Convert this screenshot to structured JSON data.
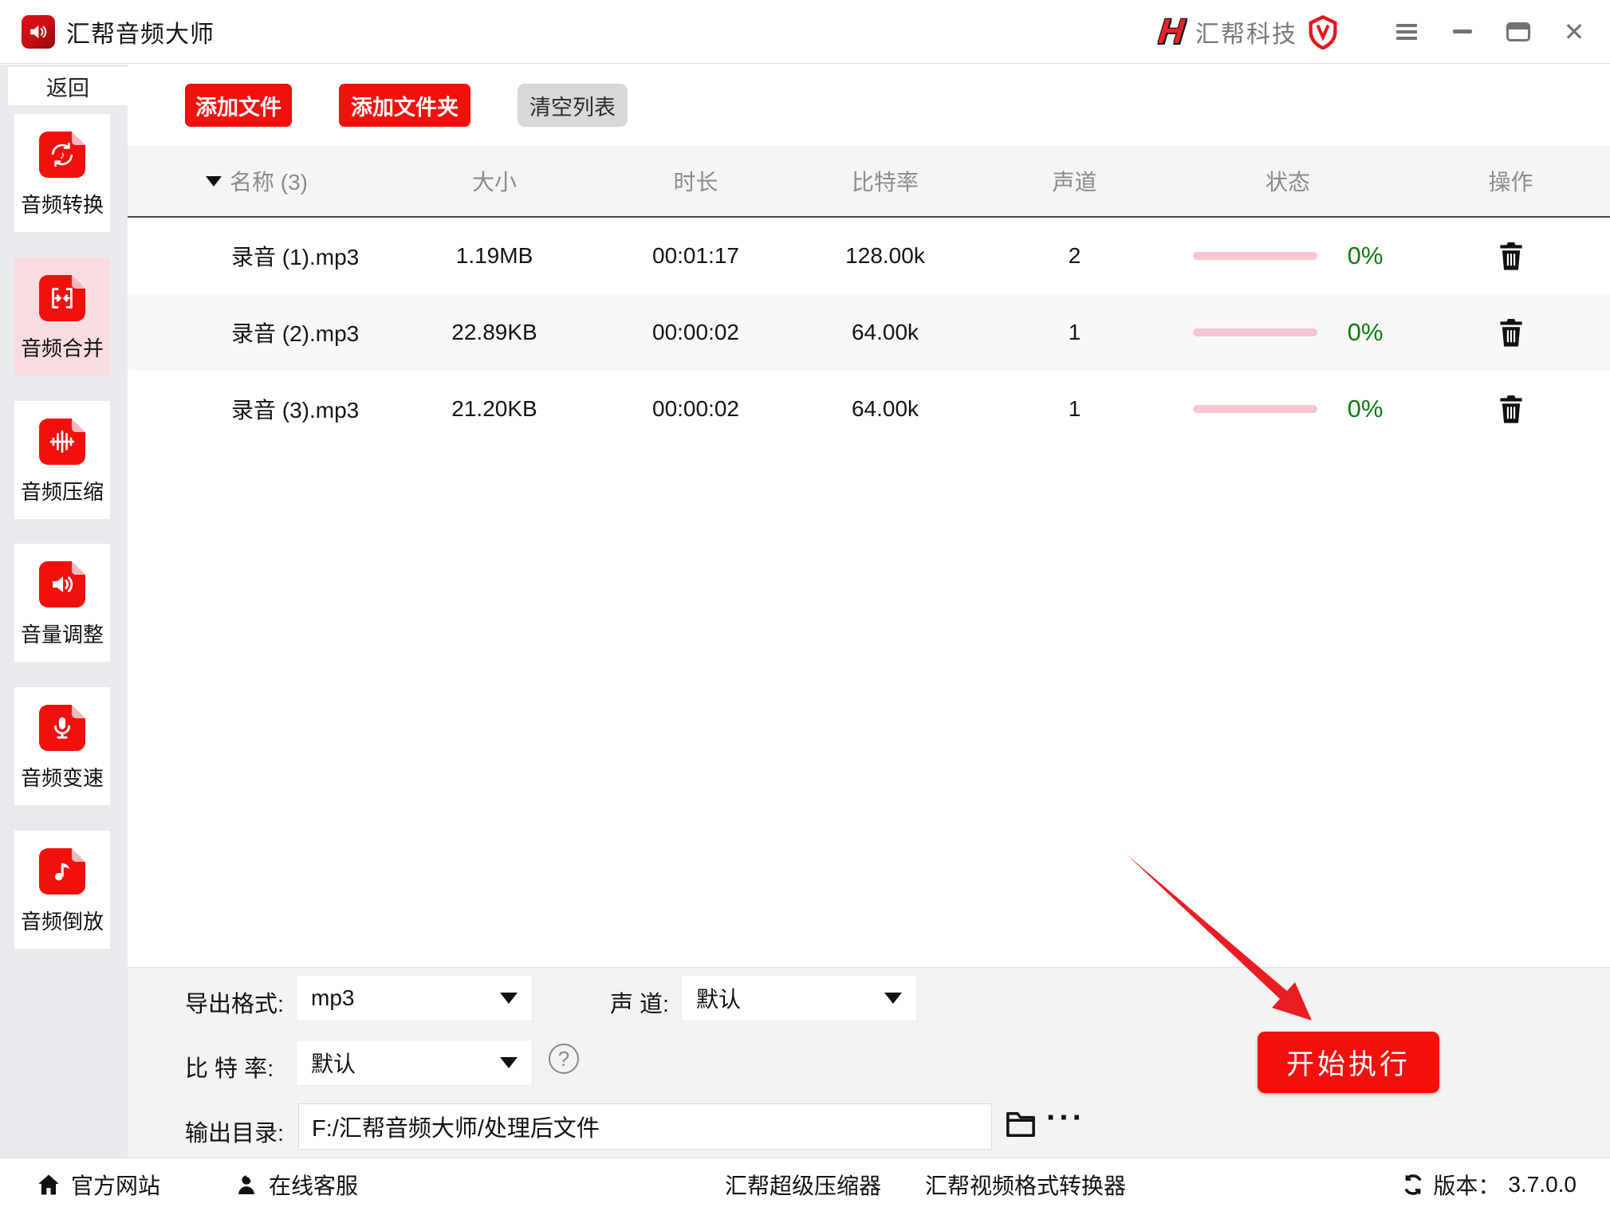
{
  "window": {
    "title": "汇帮音频大师",
    "brand_logo": "H",
    "brand_name": "汇帮科技",
    "close_glyph": "✕"
  },
  "colors": {
    "accent_red": "#f2100d",
    "selected_pink": "#f8dce0",
    "progress_pink": "#f6c6d1",
    "percent_green": "#0f7d12",
    "arrow_red": "#ec1c24"
  },
  "sidebar": {
    "back_label": "返回",
    "items": [
      {
        "label": "音频转换"
      },
      {
        "label": "音频合并"
      },
      {
        "label": "音频压缩"
      },
      {
        "label": "音量调整"
      },
      {
        "label": "音频变速"
      },
      {
        "label": "音频倒放"
      }
    ]
  },
  "toolbar": {
    "add_file": "添加文件",
    "add_folder": "添加文件夹",
    "clear_list": "清空列表"
  },
  "table": {
    "headers": {
      "name": "名称 (3)",
      "size": "大小",
      "duration": "时长",
      "bitrate": "比特率",
      "channels": "声道",
      "status": "状态",
      "action": "操作"
    },
    "rows": [
      {
        "name": "录音 (1).mp3",
        "size": "1.19MB",
        "duration": "00:01:17",
        "bitrate": "128.00k",
        "channels": "2",
        "progress_percent": "0%"
      },
      {
        "name": "录音 (2).mp3",
        "size": "22.89KB",
        "duration": "00:00:02",
        "bitrate": "64.00k",
        "channels": "1",
        "progress_percent": "0%"
      },
      {
        "name": "录音 (3).mp3",
        "size": "21.20KB",
        "duration": "00:00:02",
        "bitrate": "64.00k",
        "channels": "1",
        "progress_percent": "0%"
      }
    ]
  },
  "settings": {
    "export_format_label": "导出格式:",
    "export_format_value": "mp3",
    "channel_label": "声 道:",
    "channel_value": "默认",
    "bitrate_label": "比 特 率:",
    "bitrate_value": "默认",
    "help_glyph": "?",
    "output_dir_label": "输出目录:",
    "output_dir_value": "F:/汇帮音频大师/处理后文件",
    "more_glyph": "···",
    "start_button": "开始执行"
  },
  "footer": {
    "official_site": "官方网站",
    "online_service": "在线客服",
    "super_compressor": "汇帮超级压缩器",
    "video_converter": "汇帮视频格式转换器",
    "version_label": "版本：",
    "version_value": "3.7.0.0"
  }
}
